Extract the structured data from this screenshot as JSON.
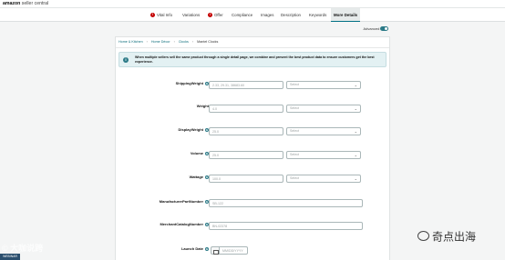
{
  "app": {
    "logo_bold": "amazon",
    "logo_rest": " seller central"
  },
  "tabs": [
    {
      "label": "Vital Info",
      "error": true
    },
    {
      "label": "Variations",
      "error": false
    },
    {
      "label": "Offer",
      "error": true
    },
    {
      "label": "Compliance",
      "error": false
    },
    {
      "label": "Images",
      "error": false
    },
    {
      "label": "Description",
      "error": false
    },
    {
      "label": "Keywords",
      "error": false
    },
    {
      "label": "More Details",
      "error": false,
      "active": true
    }
  ],
  "error_glyph": "!",
  "advanced_view": {
    "label": "Advanced View",
    "on": true
  },
  "breadcrumb": [
    "Home & Kitchen",
    "Home Décor",
    "Clocks",
    "Mantel Clocks"
  ],
  "breadcrumb_sep": "›",
  "banner": {
    "icon": "info-icon",
    "text": "When multiple sellers sell the same product through a single detail page, we combine and present the best product data to ensure customers get the best experience."
  },
  "fields": {
    "shipping_weight": {
      "label": "ShippingWeight",
      "placeholder": "2.33, 29.31, 38683.60",
      "unit": "Select"
    },
    "weight": {
      "label": "Weight",
      "placeholder": "4.0",
      "unit": "Select"
    },
    "display_weight": {
      "label": "DisplayWeight",
      "placeholder": "25.0",
      "unit": "Select"
    },
    "volume": {
      "label": "Volume",
      "placeholder": "25.0",
      "unit": "Select"
    },
    "wattage": {
      "label": "Wattage",
      "placeholder": "100.0",
      "unit": "Select"
    },
    "manufacturer_part_number": {
      "label": "ManufacturerPartNumber",
      "placeholder": "SB-122"
    },
    "merchant_catalog_number": {
      "label": "MerchantCatalogNumber",
      "placeholder": "BN-02378"
    },
    "launch_date": {
      "label": "Launch Date",
      "placeholder": "MM/DD/YYYY"
    }
  },
  "watermarks": {
    "left": "© 大咖说跨",
    "badge": "WEBINAR",
    "right": "奇点出海"
  }
}
